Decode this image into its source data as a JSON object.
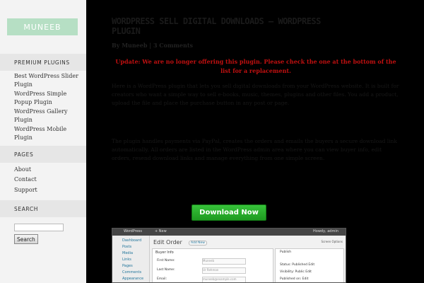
{
  "sidebar": {
    "logo": "MUNEEB",
    "premium_heading": "PREMIUM PLUGINS",
    "premium_links": [
      "Best WordPress Slider Plugin",
      "WordPress Simple Popup Plugin",
      "WordPress Gallery Plugin",
      "WordPress Mobile Plugin"
    ],
    "pages_heading": "PAGES",
    "pages_links": [
      "About",
      "Contact",
      "Support"
    ],
    "search_heading": "SEARCH",
    "search_button": "Search"
  },
  "post": {
    "title": "WORDPRESS SELL DIGITAL DOWNLOADS – WORDPRESS PLUGIN",
    "meta": "By Muneeb | 3 Comments",
    "notice": "Update: We are no longer offering this plugin. Please check the one at the bottom of the list for a replacement.",
    "para1": "Here is a WordPress plugin that lets you sell digital downloads from your WordPress website. It is built for creators who want a simple way to sell e-books, music, themes, plugins and other files. You add a product, upload the file and place the purchase button in any post or page.",
    "para2": "The plugin handles payments via PayPal, creates the orders and emails the buyers a secure download link automatically. All orders are listed in the WordPress admin area where you can view buyer info, edit orders, resend download links and manage everything from one simple screen.",
    "download_button": "Download Now"
  },
  "screenshot": {
    "topbar_items": [
      "WordPress",
      "+ New"
    ],
    "howdy": "Howdy, admin",
    "menu_items": [
      "Dashboard",
      "Posts",
      "Media",
      "Links",
      "Pages",
      "Comments",
      "Appearance"
    ],
    "edit_title": "Edit Order",
    "add_new": "Add New",
    "howdy_sub": "Screen Options",
    "box_title": "Buyer Info",
    "fields": [
      "First Name:",
      "Last Name:",
      "Email:"
    ],
    "field_values": [
      "Muneeb",
      "Ur Rehman",
      "muneeb@example.com"
    ],
    "publish_title": "Publish",
    "publish_lines": [
      "Status: Published Edit",
      "Visibility: Public Edit",
      "Published on: Edit"
    ]
  },
  "colors": {
    "accent": "#b6dfc4",
    "button_green": "#2aab2d",
    "notice_red": "#c01010"
  }
}
